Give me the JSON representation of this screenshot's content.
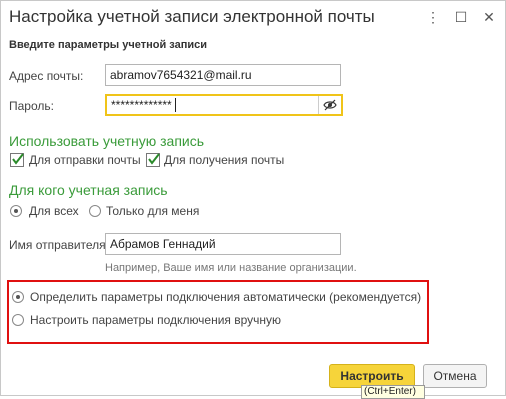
{
  "window": {
    "title": "Настройка учетной записи электронной почты",
    "more_icon": "⋮",
    "maximize_icon": "☐",
    "close_icon": "✕"
  },
  "subtitle": "Введите параметры учетной записи",
  "fields": {
    "email_label": "Адрес почты:",
    "email_value": "abramov7654321@mail.ru",
    "password_label": "Пароль:",
    "password_value": "*************"
  },
  "use_account": {
    "heading": "Использовать учетную запись",
    "send_label": "Для отправки почты",
    "send_checked": true,
    "receive_label": "Для получения почты",
    "receive_checked": true
  },
  "for_whom": {
    "heading": "Для кого учетная запись",
    "all_label": "Для всех",
    "me_label": "Только для меня",
    "selected": "all"
  },
  "sender": {
    "label": "Имя отправителя:",
    "value": "Абрамов Геннадий",
    "hint": "Например, Ваше имя или название организации."
  },
  "connection": {
    "auto_label": "Определить параметры подключения автоматически (рекомендуется)",
    "manual_label": "Настроить параметры подключения вручную",
    "selected": "auto"
  },
  "buttons": {
    "configure": "Настроить",
    "cancel": "Отмена"
  },
  "tooltip": "(Ctrl+Enter)",
  "colors": {
    "accent_green": "#3a9b3a",
    "primary_button": "#f6d43a",
    "highlight_border": "#e01010"
  }
}
